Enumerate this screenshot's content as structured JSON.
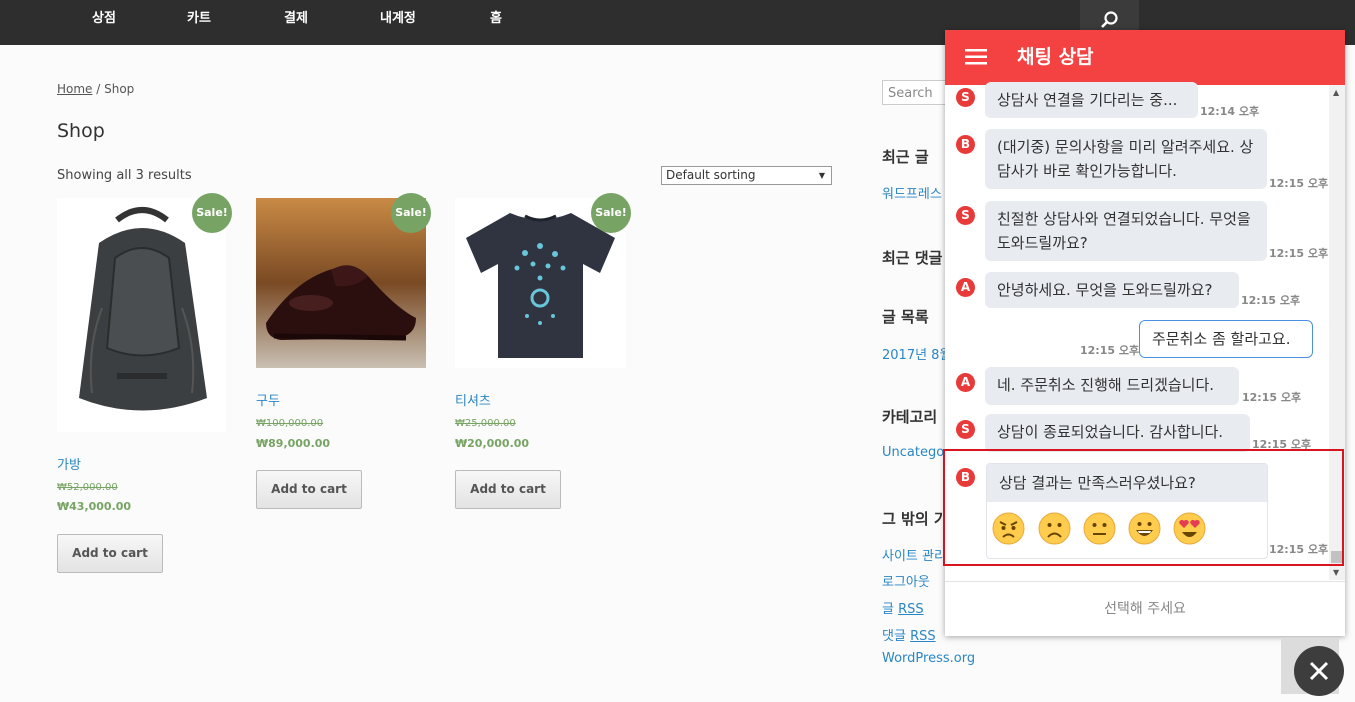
{
  "nav": {
    "items": [
      "상점",
      "카트",
      "결제",
      "내계정",
      "홈"
    ]
  },
  "breadcrumb": {
    "home": "Home",
    "sep": " / ",
    "current": "Shop"
  },
  "page": {
    "title": "Shop",
    "result_count": "Showing all 3 results",
    "sort_value": "Default sorting"
  },
  "products": [
    {
      "name": "가방",
      "old_price": "₩52,000.00",
      "price": "₩43,000.00",
      "badge": "Sale!",
      "button": "Add to cart"
    },
    {
      "name": "구두",
      "old_price": "₩100,000.00",
      "price": "₩89,000.00",
      "badge": "Sale!",
      "button": "Add to cart"
    },
    {
      "name": "티셔츠",
      "old_price": "₩25,000.00",
      "price": "₩20,000.00",
      "badge": "Sale!",
      "button": "Add to cart"
    }
  ],
  "sidebar": {
    "search_placeholder": "Search",
    "recent_posts": {
      "heading": "최근 글",
      "link": "워드프레스"
    },
    "recent_comments": {
      "heading": "최근 댓글"
    },
    "archives": {
      "heading": "글 목록",
      "link": "2017년 8월"
    },
    "categories": {
      "heading": "카테고리",
      "link": "Uncategor"
    },
    "meta": {
      "heading": "그 밖의 기",
      "links": [
        "사이트 관리",
        "로그아웃"
      ],
      "rss_entries_prefix": "글 ",
      "rss_comments_prefix": "댓글 ",
      "rss": "RSS",
      "wp": "WordPress.org"
    }
  },
  "chat": {
    "title": "채팅 상담",
    "messages": [
      {
        "avatar": "S",
        "text": "상담사 연결을 기다리는 중...",
        "time": "12:14 오후"
      },
      {
        "avatar": "B",
        "text": "(대기중) 문의사항을 미리 알려주세요. 상담사가 바로 확인가능합니다.",
        "time": "12:15 오후"
      },
      {
        "avatar": "S",
        "text": "친절한 상담사와 연결되었습니다. 무엇을 도와드릴까요?",
        "time": "12:15 오후"
      },
      {
        "avatar": "A",
        "text": "안녕하세요. 무엇을 도와드릴까요?",
        "time": "12:15 오후"
      },
      {
        "text": "주문취소 좀 할라고요.",
        "time": "12:15 오후"
      },
      {
        "avatar": "A",
        "text": "네. 주문취소 진행해 드리겠습니다.",
        "time": "12:15 오후"
      },
      {
        "avatar": "S",
        "text": "상담이 종료되었습니다. 감사합니다.",
        "time": "12:15 오후"
      }
    ],
    "feedback": {
      "avatar": "B",
      "question": "상담 결과는 만족스러우셨나요?",
      "time": "12:15 오후",
      "emoji_icons": [
        "angry-face-icon",
        "frowning-face-icon",
        "neutral-face-icon",
        "grinning-face-icon",
        "heart-eyes-face-icon"
      ]
    },
    "footer_prompt": "선택해 주세요"
  },
  "colors": {
    "accent": "#f44242",
    "nav_bg": "#2e2e2e",
    "sale": "#77a464",
    "link": "#2a86c4",
    "highlight": "#d9141e"
  }
}
